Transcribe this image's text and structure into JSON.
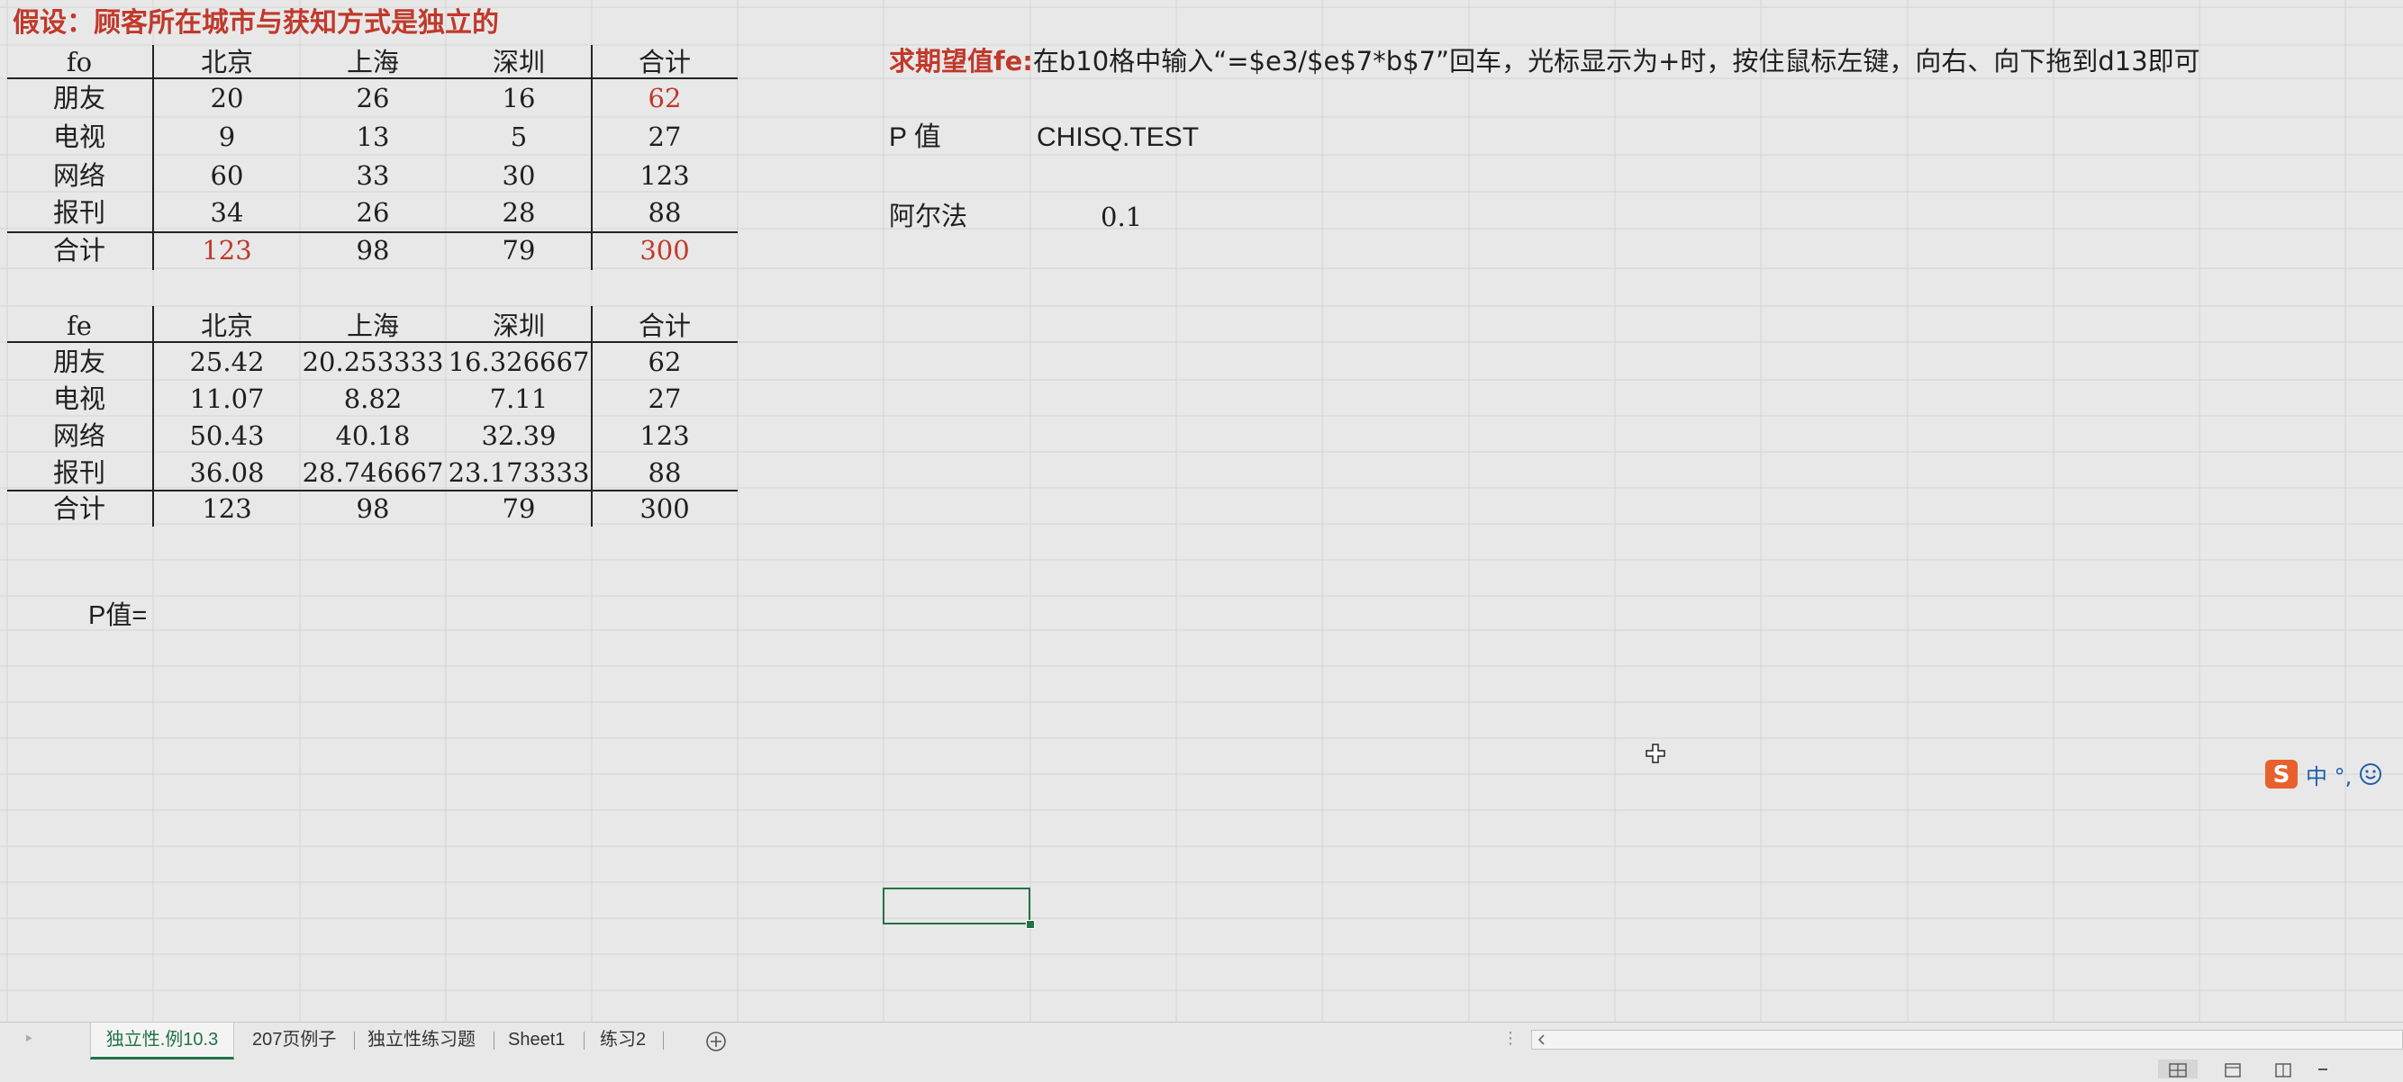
{
  "table1": {
    "title": "假设：顾客所在城市与获知方式是独立的",
    "header": [
      "fo",
      "北京",
      "上海",
      "深圳",
      "合计"
    ],
    "rows": [
      [
        "朋友",
        "20",
        "26",
        "16",
        "62"
      ],
      [
        "电视",
        "9",
        "13",
        "5",
        "27"
      ],
      [
        "网络",
        "60",
        "33",
        "30",
        "123"
      ],
      [
        "报刊",
        "34",
        "26",
        "28",
        "88"
      ],
      [
        "合计",
        "123",
        "98",
        "79",
        "300"
      ]
    ]
  },
  "table2": {
    "header": [
      "fe",
      "北京",
      "上海",
      "深圳",
      "合计"
    ],
    "rows": [
      [
        "朋友",
        "25.42",
        "20.253333",
        "16.326667",
        "62"
      ],
      [
        "电视",
        "11.07",
        "8.82",
        "7.11",
        "27"
      ],
      [
        "网络",
        "50.43",
        "40.18",
        "32.39",
        "123"
      ],
      [
        "报刊",
        "36.08",
        "28.746667",
        "23.173333",
        "88"
      ],
      [
        "合计",
        "123",
        "98",
        "79",
        "300"
      ]
    ]
  },
  "p_value_label": "P值=",
  "note": {
    "bold": "求期望值fe:",
    "text": "在b10格中输入“=$e3/$e$7*b$7”回车，光标显示为+时，按住鼠标左键，向右、向下拖到d13即可"
  },
  "p_row": {
    "label": "P 值",
    "value": "CHISQ.TEST"
  },
  "alpha_row": {
    "label": "阿尔法",
    "value": "0.1"
  },
  "sheet_tabs": [
    "独立性.例10.3",
    "207页例子",
    "独立性练习题",
    "Sheet1",
    "练习2"
  ],
  "active_tab": "独立性.例10.3",
  "add_sheet_icon": "plus-circle-icon",
  "ime_icon": "sogou-ime-icon",
  "ime_text": "中 °,",
  "colors": {
    "red_text": "#c0392b",
    "selection": "#217346",
    "grid": "#d4d4d4"
  }
}
